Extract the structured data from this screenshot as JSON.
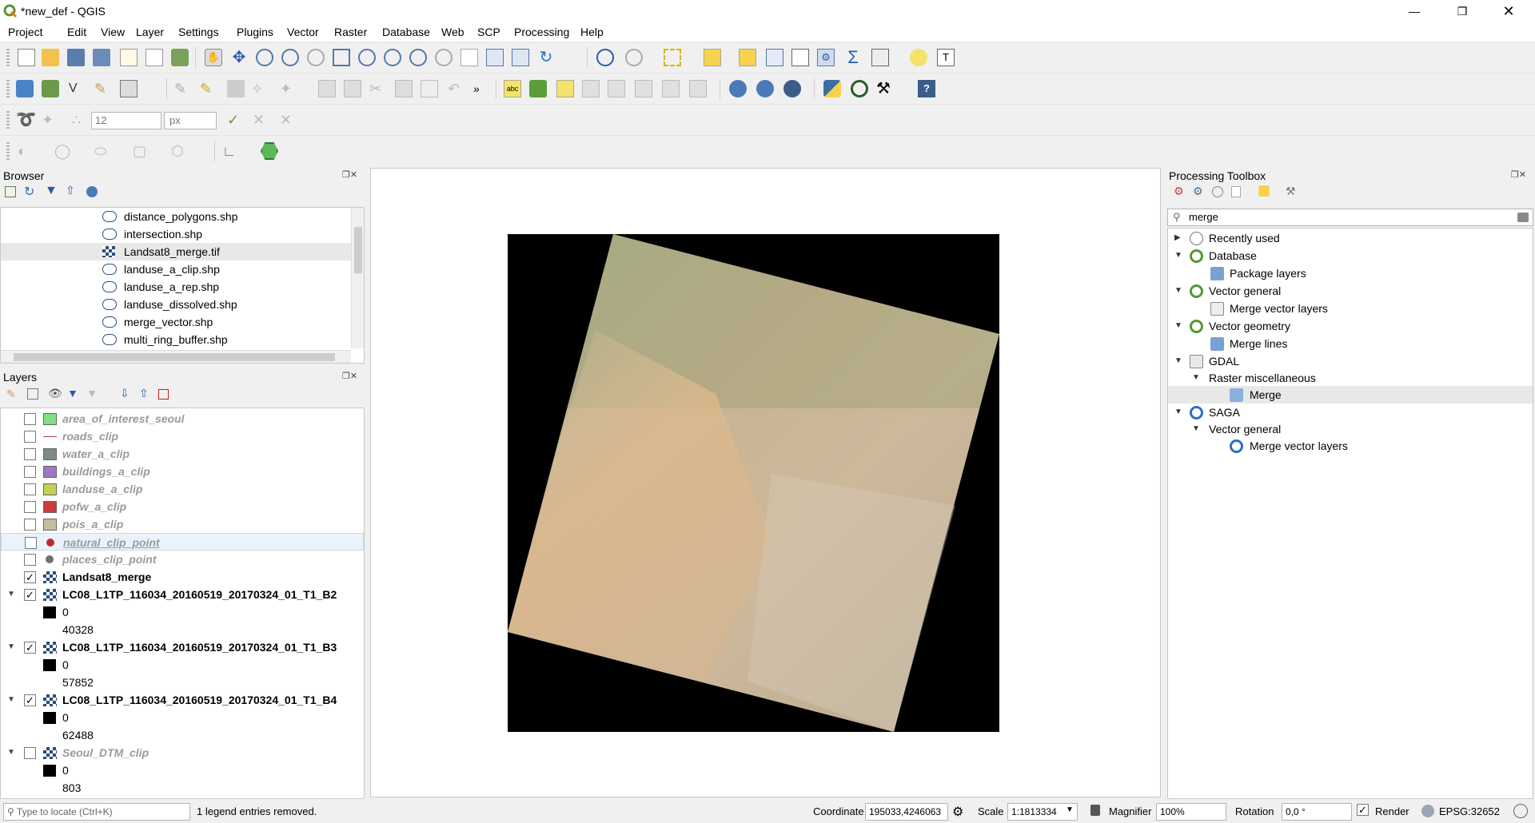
{
  "window": {
    "title": "*new_def - QGIS"
  },
  "menu": [
    "Project",
    "Edit",
    "View",
    "Layer",
    "Settings",
    "Plugins",
    "Vector",
    "Raster",
    "Database",
    "Web",
    "SCP",
    "Processing",
    "Help"
  ],
  "toolbar": {
    "snap_tolerance": "12",
    "snap_units": "px"
  },
  "browser": {
    "title": "Browser",
    "items": [
      "distance_polygons.shp",
      "intersection.shp",
      "Landsat8_merge.tif",
      "landuse_a_clip.shp",
      "landuse_a_rep.shp",
      "landuse_dissolved.shp",
      "merge_vector.shp",
      "multi_ring_buffer.shp"
    ]
  },
  "layers": {
    "title": "Layers",
    "items": [
      {
        "name": "area_of_interest_seoul",
        "color": "#7ee07e"
      },
      {
        "name": "roads_clip",
        "color": "#b04040"
      },
      {
        "name": "water_a_clip",
        "color": "#7d8a8a"
      },
      {
        "name": "buildings_a_clip",
        "color": "#9d78c4"
      },
      {
        "name": "landuse_a_clip",
        "color": "#c6cf55"
      },
      {
        "name": "pofw_a_clip",
        "color": "#d03a3a"
      },
      {
        "name": "pois_a_clip",
        "color": "#c9bd9d"
      },
      {
        "name": "natural_clip_point",
        "color": "#c02828"
      },
      {
        "name": "places_clip_point",
        "color": "#707070"
      },
      {
        "name": "Landsat8_merge"
      },
      {
        "name": "LC08_L1TP_116034_20160519_20170324_01_T1_B2",
        "min": "0",
        "max": "40328"
      },
      {
        "name": "LC08_L1TP_116034_20160519_20170324_01_T1_B3",
        "min": "0",
        "max": "57852"
      },
      {
        "name": "LC08_L1TP_116034_20160519_20170324_01_T1_B4",
        "min": "0",
        "max": "62488"
      },
      {
        "name": "Seoul_DTM_clip",
        "min": "0",
        "max": "803"
      }
    ]
  },
  "toolbox": {
    "title": "Processing Toolbox",
    "search": "merge",
    "items": {
      "recent": "Recently used",
      "database": "Database",
      "package_layers": "Package layers",
      "vector_general": "Vector general",
      "merge_vector_layers": "Merge vector layers",
      "vector_geometry": "Vector geometry",
      "merge_lines": "Merge lines",
      "gdal": "GDAL",
      "raster_misc": "Raster miscellaneous",
      "merge": "Merge",
      "saga": "SAGA",
      "saga_vector_general": "Vector general",
      "saga_merge_vector_layers": "Merge vector layers"
    }
  },
  "status": {
    "locate_placeholder": "Type to locate (Ctrl+K)",
    "message": "1 legend entries removed.",
    "coordinate_label": "Coordinate",
    "coordinate": "195033,4246063",
    "scale_label": "Scale",
    "scale": "1:1813334",
    "magnifier_label": "Magnifier",
    "magnifier": "100%",
    "rotation_label": "Rotation",
    "rotation": "0,0 °",
    "render_label": "Render",
    "crs": "EPSG:32652"
  }
}
